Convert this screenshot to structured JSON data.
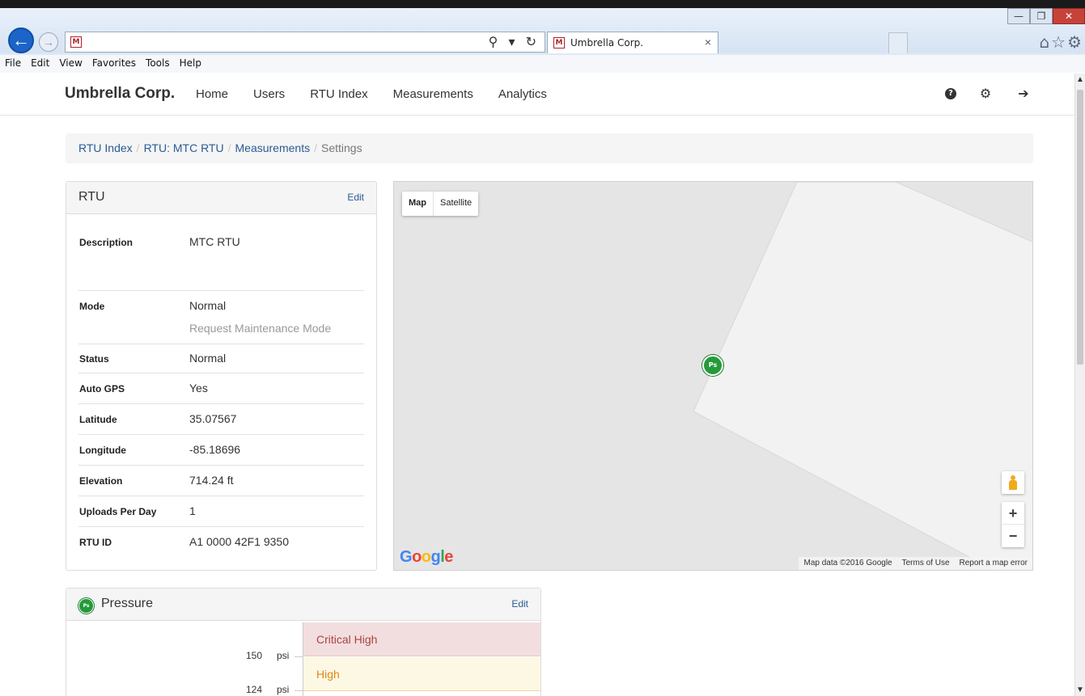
{
  "browser": {
    "tab_title": "Umbrella Corp.",
    "tab_close": "×",
    "favicon": "M",
    "back_icon": "←",
    "forward_icon": "→",
    "address_tools": "⚲ ▾ ↻",
    "window_buttons": [
      "—",
      "❐",
      "✕"
    ],
    "tool_icons": "⌂☆⚙",
    "menu": [
      "File",
      "Edit",
      "View",
      "Favorites",
      "Tools",
      "Help"
    ]
  },
  "navbar": {
    "brand": "Umbrella Corp.",
    "links": [
      "Home",
      "Users",
      "RTU Index",
      "Measurements",
      "Analytics"
    ],
    "icons": [
      "question-icon",
      "gear-icon",
      "logout-icon"
    ],
    "icon_glyphs": [
      "?",
      "⚙",
      "➔"
    ]
  },
  "breadcrumb": {
    "items": [
      "RTU Index",
      "RTU: MTC RTU",
      "Measurements"
    ],
    "current": "Settings",
    "separator": "/"
  },
  "rtu_panel": {
    "title": "RTU",
    "edit": "Edit",
    "rows": [
      {
        "label": "Description",
        "value": "MTC RTU"
      },
      {
        "label": "Mode",
        "value": "Normal",
        "sub": "Request Maintenance Mode"
      },
      {
        "label": "Status",
        "value": "Normal"
      },
      {
        "label": "Auto GPS",
        "value": "Yes"
      },
      {
        "label": "Latitude",
        "value": "35.07567"
      },
      {
        "label": "Longitude",
        "value": "-85.18696"
      },
      {
        "label": "Elevation",
        "value": "714.24 ft"
      },
      {
        "label": "Uploads Per Day",
        "value": "1"
      },
      {
        "label": "RTU ID",
        "value": "A1 0000 42F1 9350"
      }
    ]
  },
  "map": {
    "types": [
      "Map",
      "Satellite"
    ],
    "marker": "Ps",
    "zoom_in": "+",
    "zoom_out": "−",
    "logo": [
      "G",
      "o",
      "o",
      "g",
      "l",
      "e"
    ],
    "logo_colors": [
      "#4285f4",
      "#ea4335",
      "#fbbc05",
      "#4285f4",
      "#34a853",
      "#ea4335"
    ],
    "attribution": [
      "Map data ©2016 Google",
      "Terms of Use",
      "Report a map error"
    ]
  },
  "pressure_panel": {
    "title": "Pressure",
    "badge": "Ps",
    "edit": "Edit",
    "bands": [
      "Critical High",
      "High"
    ],
    "ticks": [
      {
        "value": "150",
        "unit": "psi"
      },
      {
        "value": "124",
        "unit": "psi"
      }
    ]
  },
  "colors": {
    "link": "#2a5b94",
    "marker_green": "#249a3a",
    "critical_bg": "#f2dede",
    "high_bg": "#fcf8e3"
  }
}
